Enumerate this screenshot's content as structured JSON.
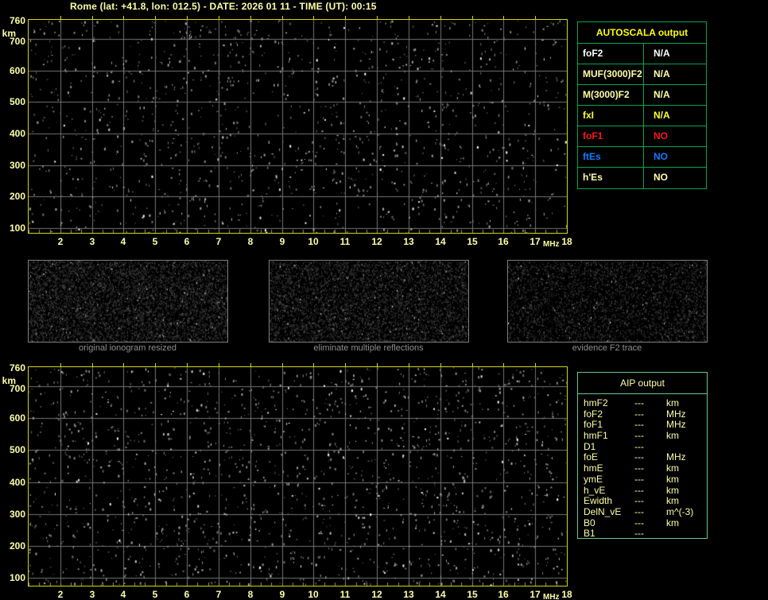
{
  "window_title": "Rome (lat: +41.8, lon: 012.5) - DATE: 2026 01 11 - TIME (UT): 00:15",
  "plots": {
    "y_unit": "km",
    "x_unit": "MHz",
    "y_tick_labels": [
      "760",
      "700",
      "600",
      "500",
      "400",
      "300",
      "200",
      "100"
    ],
    "x_tick_labels": [
      "2",
      "3",
      "4",
      "5",
      "6",
      "7",
      "8",
      "9",
      "10",
      "11",
      "12",
      "13",
      "14",
      "15",
      "16",
      "17",
      "18"
    ]
  },
  "autoscala_table": {
    "header": "AUTOSCALA output",
    "rows": [
      {
        "label": "foF2",
        "value": "N/A",
        "color": "#ffffff"
      },
      {
        "label": "MUF(3000)F2",
        "value": "N/A",
        "color": "#ffffa4"
      },
      {
        "label": "M(3000)F2",
        "value": "N/A",
        "color": "#ffffa4"
      },
      {
        "label": "fxI",
        "value": "N/A",
        "color": "#ffff30"
      },
      {
        "label": "foF1",
        "value": "NO",
        "color": "#ff1515"
      },
      {
        "label": "ftEs",
        "value": "NO",
        "color": "#0a7cff"
      },
      {
        "label": "h'Es",
        "value": "NO",
        "color": "#ffffa4"
      }
    ]
  },
  "thumbnails": [
    {
      "caption": "original ionogram resized"
    },
    {
      "caption": "eliminate multiple reflections"
    },
    {
      "caption": "evidence F2 trace"
    }
  ],
  "aip_table": {
    "header": "AIP output",
    "rows": [
      {
        "label": "hmF2",
        "value": "---",
        "unit": "km"
      },
      {
        "label": "foF2",
        "value": "---",
        "unit": "MHz"
      },
      {
        "label": "foF1",
        "value": "---",
        "unit": "MHz"
      },
      {
        "label": "hmF1",
        "value": "---",
        "unit": "km"
      },
      {
        "label": "D1",
        "value": "---",
        "unit": ""
      },
      {
        "label": "foE",
        "value": "---",
        "unit": "MHz"
      },
      {
        "label": "hmE",
        "value": "---",
        "unit": "km"
      },
      {
        "label": "ymE",
        "value": "---",
        "unit": "km"
      },
      {
        "label": "h_vE",
        "value": "---",
        "unit": "km"
      },
      {
        "label": "Ewidth",
        "value": "---",
        "unit": "km"
      },
      {
        "label": "DelN_vE",
        "value": "---",
        "unit": "m^(-3)"
      },
      {
        "label": "B0",
        "value": "---",
        "unit": "km"
      },
      {
        "label": "B1",
        "value": "---",
        "unit": ""
      }
    ]
  },
  "colors": {
    "background": "#000000",
    "title_text": "#ffffa4",
    "axis_text": "#ffffa4",
    "plot_border": "#d6d600",
    "grid_line": "#757575",
    "minor_tick": "#909090",
    "autoscala_border": "#00a550",
    "autoscala_header": "#ffff00",
    "aip_border": "#63c98a",
    "aip_text": "#ffffa4",
    "caption_text": "#8f8f8f",
    "thumbnail_border": "#7d7d7d"
  }
}
